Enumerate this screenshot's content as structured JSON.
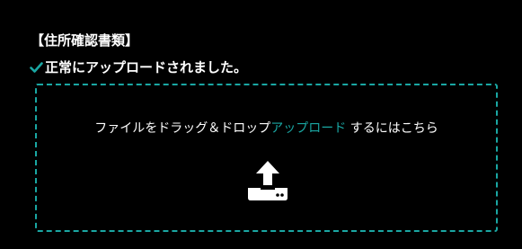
{
  "section": {
    "title": "【住所確認書類】"
  },
  "status": {
    "icon": "check-icon",
    "message": "正常にアップロードされました。",
    "color": "#1aa7a3"
  },
  "dropzone": {
    "text_before": "ファイルをドラッグ＆ドロップ",
    "link_text": "アップロード",
    "text_after": " するにはこちら",
    "icon": "upload-icon",
    "border_color": "#1aa7a3"
  }
}
